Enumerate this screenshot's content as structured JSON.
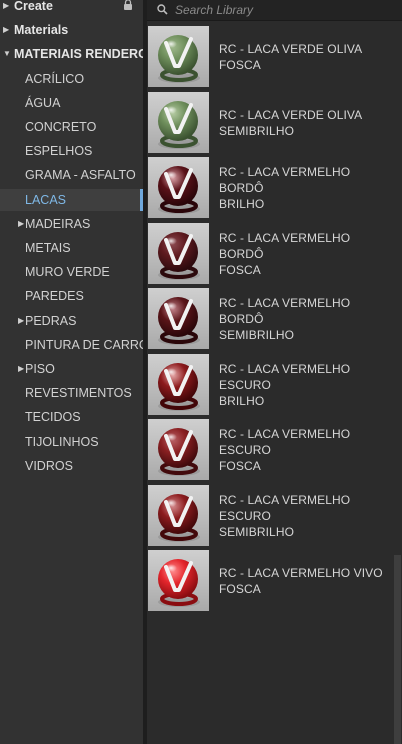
{
  "sidebar": {
    "items": [
      {
        "label": "Create",
        "caret": "right",
        "level": 0,
        "bold": true,
        "lock": true
      },
      {
        "label": "Materials",
        "caret": "right",
        "level": 0,
        "bold": true
      },
      {
        "label": "MATERIAIS RENDERC...",
        "caret": "down",
        "level": 0,
        "bold": true
      },
      {
        "label": "ACRÍLICO",
        "level": 1
      },
      {
        "label": "ÁGUA",
        "level": 1
      },
      {
        "label": "CONCRETO",
        "level": 1
      },
      {
        "label": "ESPELHOS",
        "level": 1
      },
      {
        "label": "GRAMA - ASFALTO",
        "level": 1
      },
      {
        "label": "LACAS",
        "level": 1,
        "selected": true
      },
      {
        "label": "MADEIRAS",
        "caret": "right",
        "level": 1
      },
      {
        "label": "METAIS",
        "level": 1
      },
      {
        "label": "MURO VERDE",
        "level": 1
      },
      {
        "label": "PAREDES",
        "level": 1
      },
      {
        "label": "PEDRAS",
        "caret": "right",
        "level": 1
      },
      {
        "label": "PINTURA DE CARRO",
        "level": 1
      },
      {
        "label": "PISO",
        "caret": "right",
        "level": 1
      },
      {
        "label": "REVESTIMENTOS",
        "level": 1
      },
      {
        "label": "TECIDOS",
        "level": 1
      },
      {
        "label": "TIJOLINHOS",
        "level": 1
      },
      {
        "label": "VIDROS",
        "level": 1
      }
    ]
  },
  "search": {
    "placeholder": "Search Library",
    "value": ""
  },
  "materials": [
    {
      "line1": "RC - LACA VERDE OLIVA FOSCA",
      "line2": "",
      "color": "#6f8f5c",
      "highlight": "#9fb88c",
      "dark": "#3b5230"
    },
    {
      "line1": "RC - LACA VERDE OLIVA",
      "line2": "SEMIBRILHO",
      "color": "#6f8f5c",
      "highlight": "#b5cba3",
      "dark": "#3b5230"
    },
    {
      "line1": "RC - LACA VERMELHO BORDÔ",
      "line2": "BRILHO",
      "color": "#5a1219",
      "highlight": "#d9a0a6",
      "dark": "#2a0509"
    },
    {
      "line1": "RC - LACA VERMELHO BORDÔ",
      "line2": "FOSCA",
      "color": "#5e1a1f",
      "highlight": "#8c4a50",
      "dark": "#2c0a0d"
    },
    {
      "line1": "RC - LACA VERMELHO BORDÔ",
      "line2": "SEMIBRILHO",
      "color": "#5a1519",
      "highlight": "#c08088",
      "dark": "#2a0609"
    },
    {
      "line1": "RC - LACA VERMELHO ESCURO",
      "line2": "BRILHO",
      "color": "#8c1a1c",
      "highlight": "#e6a8a8",
      "dark": "#420608"
    },
    {
      "line1": "RC - LACA VERMELHO ESCURO",
      "line2": "FOSCA",
      "color": "#8a2022",
      "highlight": "#b86064",
      "dark": "#420a0c"
    },
    {
      "line1": "RC - LACA VERMELHO ESCURO",
      "line2": "SEMIBRILHO",
      "color": "#8c1c1e",
      "highlight": "#d48a8c",
      "dark": "#43080a"
    },
    {
      "line1": "RC - LACA VERMELHO VIVO",
      "line2": "FOSCA",
      "color": "#e4262c",
      "highlight": "#ff8a8c",
      "dark": "#8a0c10"
    }
  ]
}
